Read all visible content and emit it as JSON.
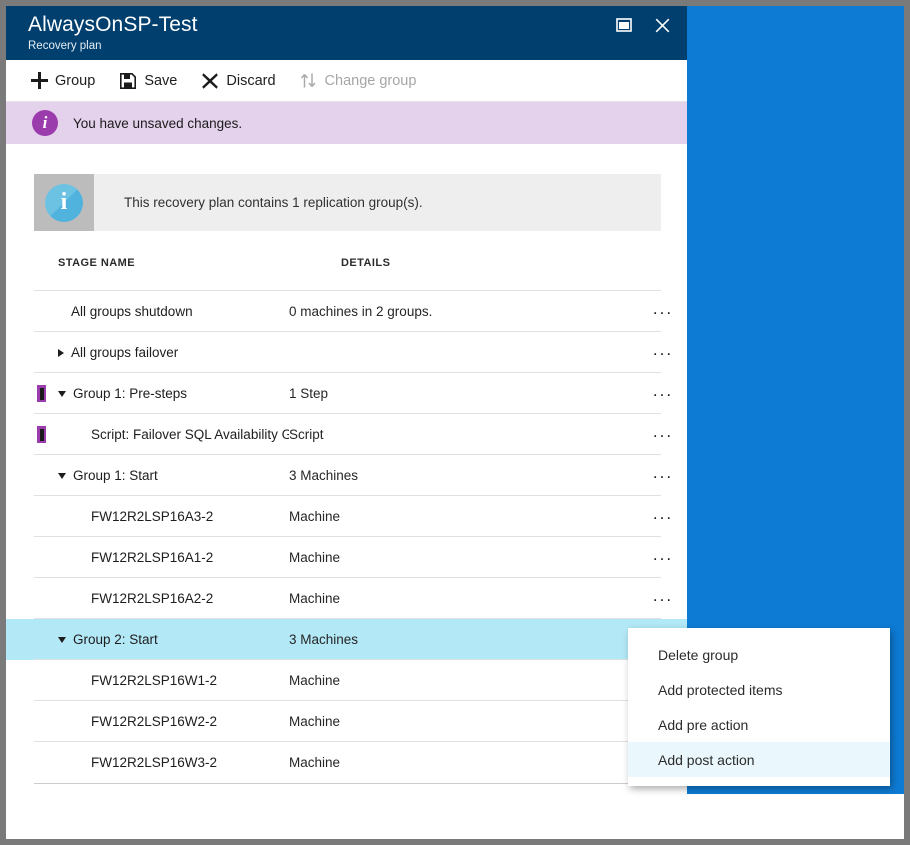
{
  "window": {
    "title": "AlwaysOnSP-Test",
    "subtitle": "Recovery plan",
    "restore_icon": "restore-icon",
    "close_icon": "close-icon"
  },
  "toolbar": {
    "items": [
      {
        "label": "Group",
        "icon": "plus-icon",
        "disabled": false
      },
      {
        "label": "Save",
        "icon": "save-disk-icon",
        "disabled": false
      },
      {
        "label": "Discard",
        "icon": "cross-icon",
        "disabled": false
      },
      {
        "label": "Change group",
        "icon": "swap-arrows-icon",
        "disabled": true
      }
    ]
  },
  "banner": {
    "icon": "info-circle-icon",
    "text": "You have unsaved changes.",
    "background": "#e4d2ec",
    "icon_color": "#9b3cad"
  },
  "infobox": {
    "icon": "info-circle-large-icon",
    "text": "This recovery plan contains 1 replication group(s).",
    "background": "#eeeeee",
    "icon_cell_background": "#bcbcbc",
    "icon_color": "#5fbde0"
  },
  "table": {
    "columns": [
      "STAGE NAME",
      "DETAILS"
    ],
    "selected_color": "#b3e8f7",
    "marker_color": "#9b3cad",
    "rows": [
      {
        "stage": "All groups shutdown",
        "details": "0 machines in 2 groups.",
        "indent": 0,
        "toggle": "none",
        "marker": false,
        "selected": false,
        "more": "..."
      },
      {
        "stage": "All groups failover",
        "details": "",
        "indent": 0,
        "toggle": "right",
        "marker": false,
        "selected": false,
        "more": "..."
      },
      {
        "stage": "Group 1: Pre-steps",
        "details": "1 Step",
        "indent": 0,
        "toggle": "down",
        "marker": true,
        "selected": false,
        "more": "..."
      },
      {
        "stage": "Script: Failover SQL Availability Gro...",
        "details": "Script",
        "indent": 1,
        "toggle": "none",
        "marker": true,
        "selected": false,
        "more": "..."
      },
      {
        "stage": "Group 1: Start",
        "details": "3 Machines",
        "indent": 0,
        "toggle": "down",
        "marker": false,
        "selected": false,
        "more": "..."
      },
      {
        "stage": "FW12R2LSP16A3-2",
        "details": "Machine",
        "indent": 1,
        "toggle": "none",
        "marker": false,
        "selected": false,
        "more": "..."
      },
      {
        "stage": "FW12R2LSP16A1-2",
        "details": "Machine",
        "indent": 1,
        "toggle": "none",
        "marker": false,
        "selected": false,
        "more": "..."
      },
      {
        "stage": "FW12R2LSP16A2-2",
        "details": "Machine",
        "indent": 1,
        "toggle": "none",
        "marker": false,
        "selected": false,
        "more": "..."
      },
      {
        "stage": "Group 2: Start",
        "details": "3 Machines",
        "indent": 0,
        "toggle": "down",
        "marker": false,
        "selected": true,
        "more": "..."
      },
      {
        "stage": "FW12R2LSP16W1-2",
        "details": "Machine",
        "indent": 1,
        "toggle": "none",
        "marker": false,
        "selected": false,
        "more": "..."
      },
      {
        "stage": "FW12R2LSP16W2-2",
        "details": "Machine",
        "indent": 1,
        "toggle": "none",
        "marker": false,
        "selected": false,
        "more": "..."
      },
      {
        "stage": "FW12R2LSP16W3-2",
        "details": "Machine",
        "indent": 1,
        "toggle": "none",
        "marker": false,
        "selected": false,
        "more": "..."
      }
    ]
  },
  "context_menu": {
    "items": [
      {
        "label": "Delete group",
        "hover": false
      },
      {
        "label": "Add protected items",
        "hover": false
      },
      {
        "label": "Add pre action",
        "hover": false
      },
      {
        "label": "Add post action",
        "hover": true
      }
    ],
    "hover_color": "#eaf7fc"
  },
  "colors": {
    "titlebar": "#003f6e",
    "desktop": "#0d7bd4",
    "frame": "#7a7a7a"
  }
}
